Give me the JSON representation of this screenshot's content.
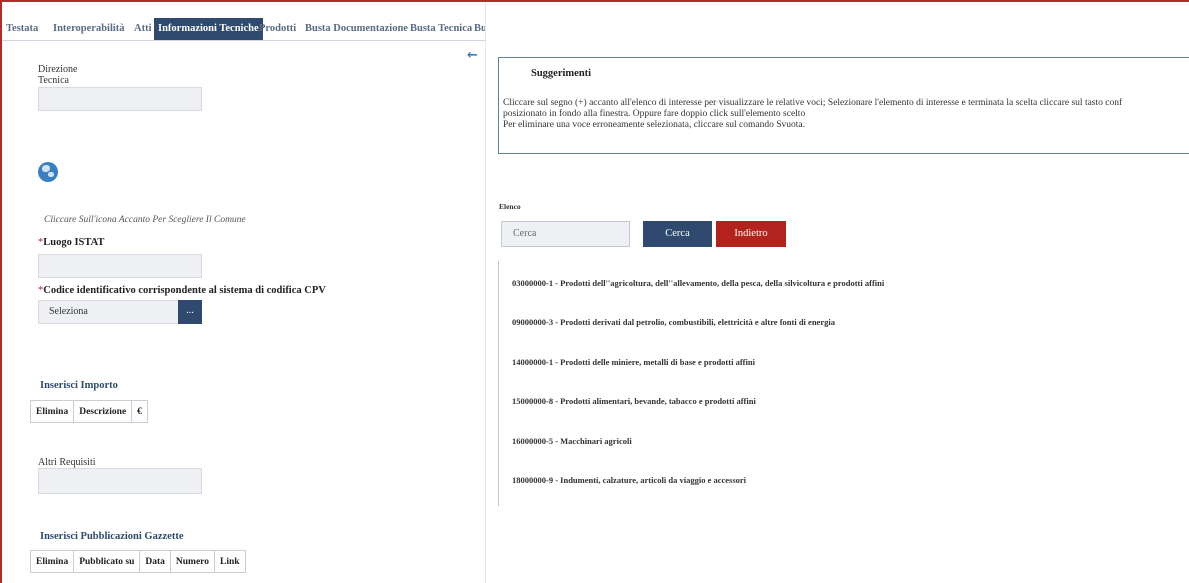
{
  "tabs": [
    {
      "label": "Testata"
    },
    {
      "label": "Interoperabilità"
    },
    {
      "label": "Atti"
    },
    {
      "label": "Informazioni Tecniche",
      "active": true
    },
    {
      "label": "Prodotti"
    },
    {
      "label": "Busta Documentazione"
    },
    {
      "label": "Busta Tecnica"
    },
    {
      "label": "Bu"
    }
  ],
  "form": {
    "direzione_label_1": "Direzione",
    "direzione_label_2": "Tecnica",
    "comune_hint": "Cliccare Sull'icona Accanto Per Scegliere Il Comune",
    "luogo_istat_label": "Luogo ISTAT",
    "cpv_label": "Codice identificativo corrispondente al sistema di codifica CPV",
    "cpv_select_value": "Seleziona",
    "cpv_button_label": "...",
    "required_mark": "*",
    "importo_title": "Inserisci Importo",
    "importo_columns": [
      "Elimina",
      "Descrizione",
      "€"
    ],
    "altri_requisiti_label": "Altri Requisiti",
    "gazzette_title": "Inserisci Pubblicazioni Gazzette",
    "gazzette_columns": [
      "Elimina",
      "Pubblicato su",
      "Data",
      "Numero",
      "Link"
    ]
  },
  "icons": {
    "collapse": "arrow-left-icon",
    "globe": "globe-icon",
    "collapse_glyph": "←"
  },
  "suggerimenti": {
    "title": "Suggerimenti",
    "line1": "Cliccare sul segno (+) accanto all'elenco di interesse per visualizzare le relative voci; Selezionare l'elemento di interesse e terminata la scelta cliccare sul tasto conf",
    "line2": "posizionato in fondo alla finestra. Oppure fare doppio click sull'elemento scelto",
    "line3": "Per eliminare una voce erroneamente selezionata, cliccare sul comando Svuota."
  },
  "elenco": {
    "label": "Elenco",
    "search_placeholder": "Cerca",
    "search_button": "Cerca",
    "back_button": "Indietro",
    "items": [
      "03000000-1 - Prodotti dell''agricoltura, dell''allevamento, della pesca, della silvicoltura e prodotti affini",
      "09000000-3 - Prodotti derivati dal petrolio, combustibili, elettricità e altre fonti di energia",
      "14000000-1 - Prodotti delle miniere, metalli di base e prodotti affini",
      "15000000-8 - Prodotti alimentari, bevande, tabacco e prodotti affini",
      "16000000-5 - Macchinari agricoli",
      "18000000-9 - Indumenti, calzature, articoli da viaggio e accessori"
    ]
  },
  "colors": {
    "accent_blue": "#2f4a6e",
    "accent_red": "#b1231c",
    "frame_red": "#b5292a"
  }
}
